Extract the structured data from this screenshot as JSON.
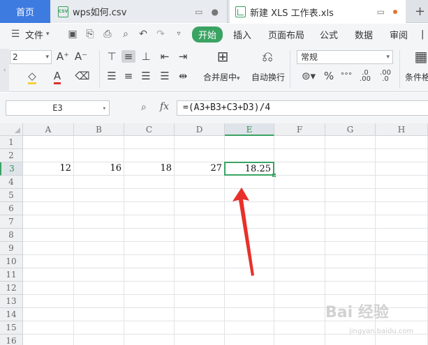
{
  "tabs": {
    "home": "首页",
    "csv": {
      "label": "wps如何.csv",
      "icon": "CSV"
    },
    "xls": {
      "label": "新建 XLS 工作表.xls"
    }
  },
  "menu": {
    "file": "文件",
    "start": "开始",
    "insert": "插入",
    "page_layout": "页面布局",
    "formula": "公式",
    "data": "数据",
    "review": "审阅"
  },
  "ribbon": {
    "font_size": "2",
    "merge_center": "合并居中",
    "wrap_text": "自动换行",
    "number_format": "常规",
    "conditional_format": "条件格"
  },
  "formula_bar": {
    "name_box": "E3",
    "fx": "fx",
    "formula": "=(A3+B3+C3+D3)/4"
  },
  "grid": {
    "columns": [
      "A",
      "B",
      "C",
      "D",
      "E",
      "F",
      "G",
      "H"
    ],
    "rows": [
      "1",
      "2",
      "3",
      "4",
      "5",
      "6",
      "7",
      "8",
      "9",
      "10",
      "11",
      "12",
      "13",
      "14",
      "15",
      "16"
    ],
    "active_column": "E",
    "active_row": "3",
    "row3_values": [
      "12",
      "16",
      "18",
      "27",
      "18.25"
    ]
  },
  "watermark": {
    "text": "Bai 经验",
    "sub": "jingyan.baidu.com"
  },
  "colors": {
    "accent_green": "#3aa363",
    "home_tab_blue": "#3d7be0",
    "arrow_red": "#e8302a"
  }
}
